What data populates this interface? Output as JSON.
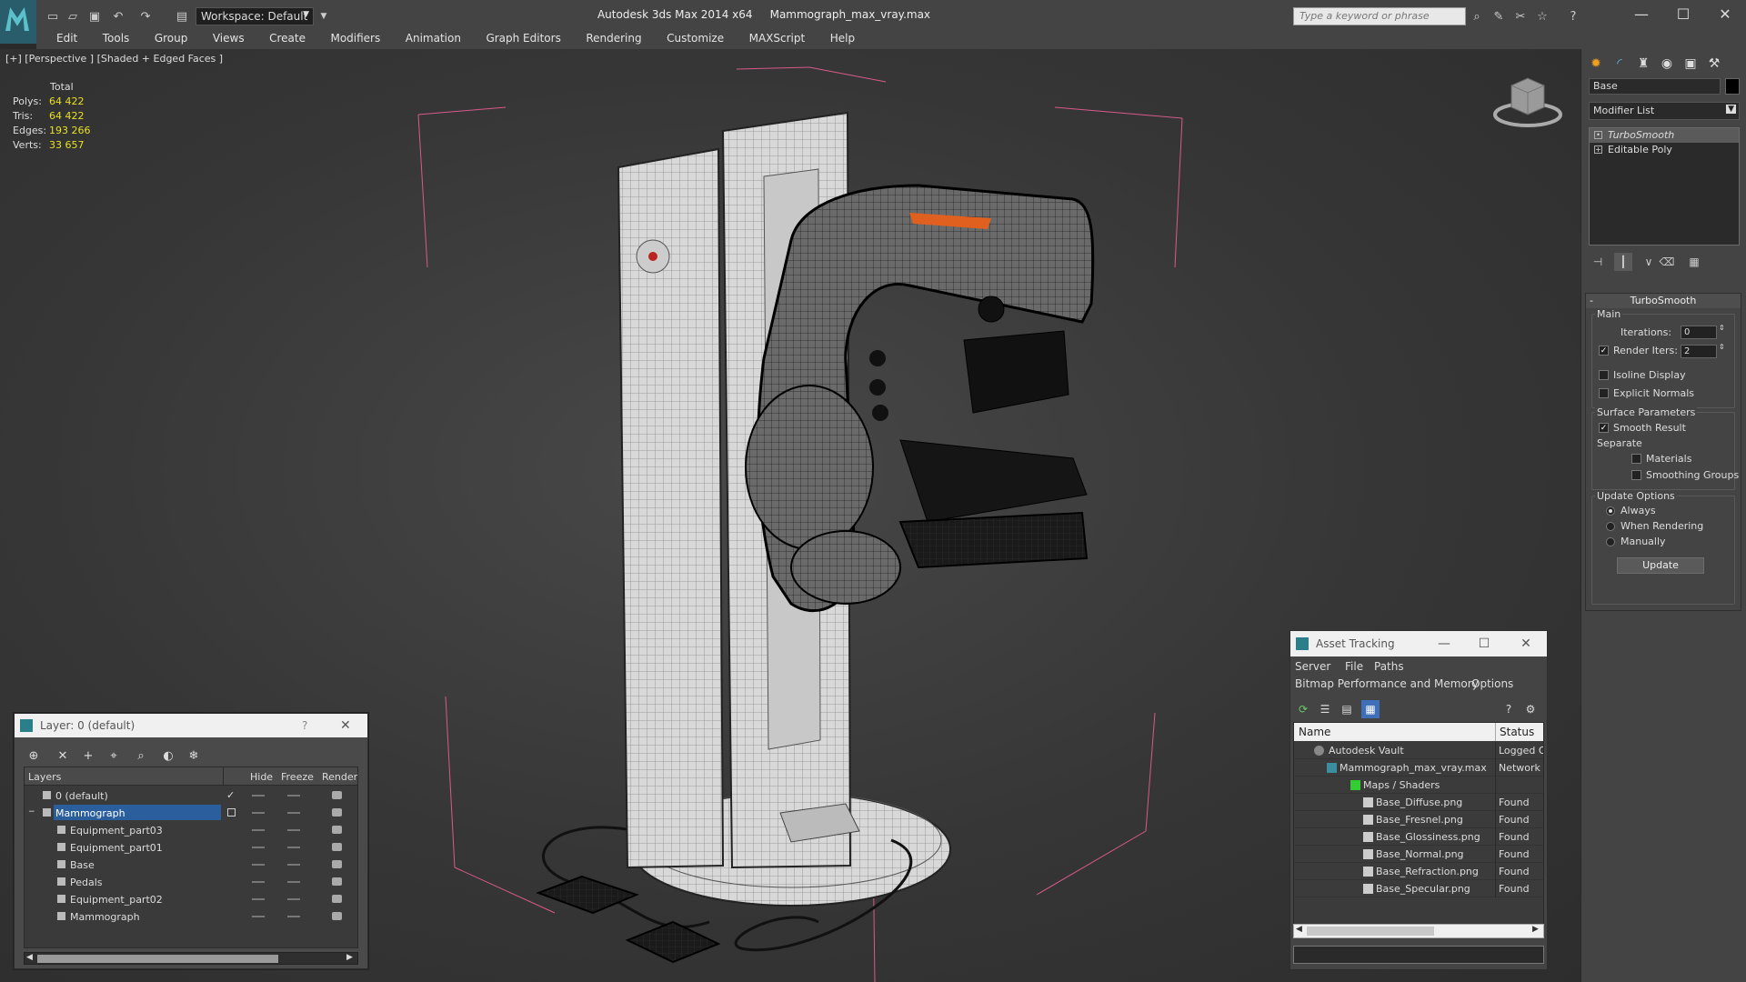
{
  "app": {
    "title": "Autodesk 3ds Max  2014 x64",
    "filename": "Mammograph_max_vray.max",
    "workspace_label": "Workspace: Default",
    "search_placeholder": "Type a keyword or phrase"
  },
  "menu": [
    "Edit",
    "Tools",
    "Group",
    "Views",
    "Create",
    "Modifiers",
    "Animation",
    "Graph Editors",
    "Rendering",
    "Customize",
    "MAXScript",
    "Help"
  ],
  "viewport": {
    "label": "[+] [Perspective ] [Shaded + Edged Faces ]",
    "stats": {
      "header": "Total",
      "rows": [
        {
          "k": "Polys:",
          "v": "64 422"
        },
        {
          "k": "Tris:",
          "v": "64 422"
        },
        {
          "k": "Edges:",
          "v": "193 266"
        },
        {
          "k": "Verts:",
          "v": "33 657"
        }
      ]
    }
  },
  "command_panel": {
    "object_name": "Base",
    "modifier_list_label": "Modifier List",
    "stack": [
      "TurboSmooth",
      "Editable Poly"
    ],
    "turbosmooth": {
      "title": "TurboSmooth",
      "main_label": "Main",
      "iterations_label": "Iterations:",
      "iterations_value": "0",
      "render_iters_label": "Render Iters:",
      "render_iters_value": "2",
      "isoline_label": "Isoline Display",
      "explicit_normals_label": "Explicit Normals",
      "surface_params_label": "Surface Parameters",
      "smooth_result_label": "Smooth Result",
      "separate_label": "Separate",
      "materials_label": "Materials",
      "smoothing_groups_label": "Smoothing Groups",
      "update_options_label": "Update Options",
      "always_label": "Always",
      "when_rendering_label": "When Rendering",
      "manually_label": "Manually",
      "update_button": "Update"
    }
  },
  "layer_dialog": {
    "title": "Layer: 0 (default)",
    "help": "?",
    "columns": {
      "layers": "Layers",
      "hide": "Hide",
      "freeze": "Freeze",
      "render": "Render"
    },
    "rows": [
      {
        "name": "0 (default)",
        "indent": 0
      },
      {
        "name": "Mammograph",
        "indent": 0
      },
      {
        "name": "Equipment_part03",
        "indent": 1
      },
      {
        "name": "Equipment_part01",
        "indent": 1
      },
      {
        "name": "Base",
        "indent": 1
      },
      {
        "name": "Pedals",
        "indent": 1
      },
      {
        "name": "Equipment_part02",
        "indent": 1
      },
      {
        "name": "Mammograph",
        "indent": 1
      }
    ]
  },
  "asset_tracking": {
    "title": "Asset Tracking",
    "menu1": [
      "Server",
      "File",
      "Paths"
    ],
    "menu2": [
      "Bitmap Performance and Memory",
      "Options"
    ],
    "columns": {
      "name": "Name",
      "status": "Status"
    },
    "rows": [
      {
        "name": "Autodesk Vault",
        "status": "Logged Ou",
        "indent": 1
      },
      {
        "name": "Mammograph_max_vray.max",
        "status": "Network P",
        "indent": 2
      },
      {
        "name": "Maps / Shaders",
        "status": "",
        "indent": 3
      },
      {
        "name": "Base_Diffuse.png",
        "status": "Found",
        "indent": 4
      },
      {
        "name": "Base_Fresnel.png",
        "status": "Found",
        "indent": 4
      },
      {
        "name": "Base_Glossiness.png",
        "status": "Found",
        "indent": 4
      },
      {
        "name": "Base_Normal.png",
        "status": "Found",
        "indent": 4
      },
      {
        "name": "Base_Refraction.png",
        "status": "Found",
        "indent": 4
      },
      {
        "name": "Base_Specular.png",
        "status": "Found",
        "indent": 4
      }
    ]
  },
  "colors": {
    "selection": "#2a5e9c",
    "stat_value": "#e8e020",
    "bbox": "#d85a8a",
    "accent_orange": "#e06020"
  }
}
